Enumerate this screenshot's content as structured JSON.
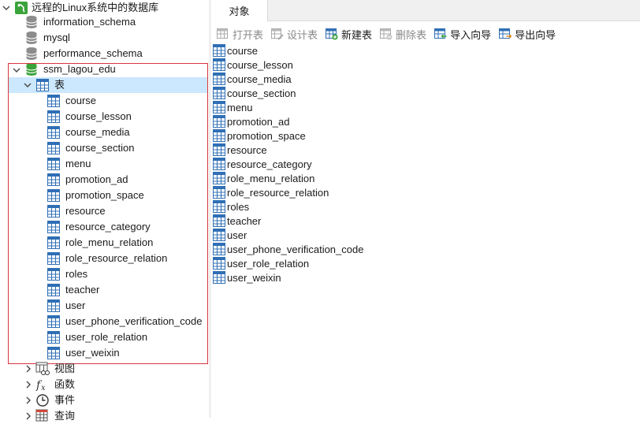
{
  "tree": {
    "connection": "远程的Linux系统中的数据库",
    "databases": [
      "information_schema",
      "mysql",
      "performance_schema"
    ],
    "active_db": "ssm_lagou_edu",
    "tables_group": "表",
    "tables": [
      "course",
      "course_lesson",
      "course_media",
      "course_section",
      "menu",
      "promotion_ad",
      "promotion_space",
      "resource",
      "resource_category",
      "role_menu_relation",
      "role_resource_relation",
      "roles",
      "teacher",
      "user",
      "user_phone_verification_code",
      "user_role_relation",
      "user_weixin"
    ],
    "groups": {
      "views": "视图",
      "functions": "函数",
      "events": "事件",
      "queries": "查询"
    }
  },
  "tabs": {
    "objects": "对象"
  },
  "toolbar": {
    "open": "打开表",
    "design": "设计表",
    "new": "新建表",
    "delete": "删除表",
    "import": "导入向导",
    "export": "导出向导"
  },
  "colors": {
    "selection": "#cce8ff",
    "highlight_border": "#d9363e",
    "db_active": "#3aa33a",
    "table_icon": "#2f6fb5"
  }
}
